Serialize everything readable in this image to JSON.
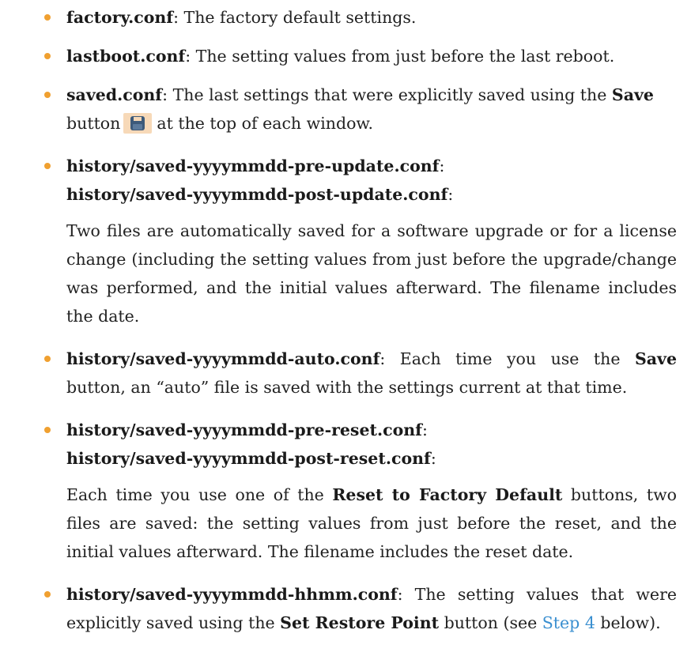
{
  "items": [
    {
      "name": "factory.conf",
      "desc": ": The factory default settings."
    },
    {
      "name": "lastboot.conf",
      "desc": ": The setting values from just before the last reboot."
    },
    {
      "name": "saved.conf",
      "desc_a": ": The last settings that were explicitly saved using the ",
      "save": "Save",
      "desc_b": "button",
      "desc_c": "at the top of each window."
    },
    {
      "name_a": "history/saved-yyyymmdd-pre-update.conf",
      "name_b": "history/saved-yyyymmdd-post-update.conf",
      "colon": ":",
      "para": "Two files are automatically saved for a software upgrade or for a license change (including the setting values from just before the upgrade/change was performed, and the initial values afterward. The filename includes the date."
    },
    {
      "name": "history/saved-yyyymmdd-auto.conf",
      "desc_a": ": Each time you use the ",
      "save": "Save",
      "desc_b": " button, an “auto” file is saved with the settings current at that time."
    },
    {
      "name_a": "history/saved-yyyymmdd-pre-reset.conf",
      "name_b": "history/saved-yyyymmdd-post-reset.conf",
      "colon": ":",
      "para_a": "Each time you use one of the ",
      "reset": "Reset to Factory Default",
      "para_b": " buttons, two files are saved: the setting values from just before the reset, and the initial values afterward. The filename includes the reset date."
    },
    {
      "name": "history/saved-yyyymmdd-hhmm.conf",
      "desc_a": ": The setting values that were explicitly saved using the ",
      "restore": "Set Restore Point",
      "desc_b": " button (see ",
      "link": "Step 4",
      "desc_c": " below)."
    }
  ],
  "icons": {
    "save_icon": "floppy-disk-icon",
    "bullet_color": "#f0a030",
    "link_color": "#3a8fd0"
  }
}
